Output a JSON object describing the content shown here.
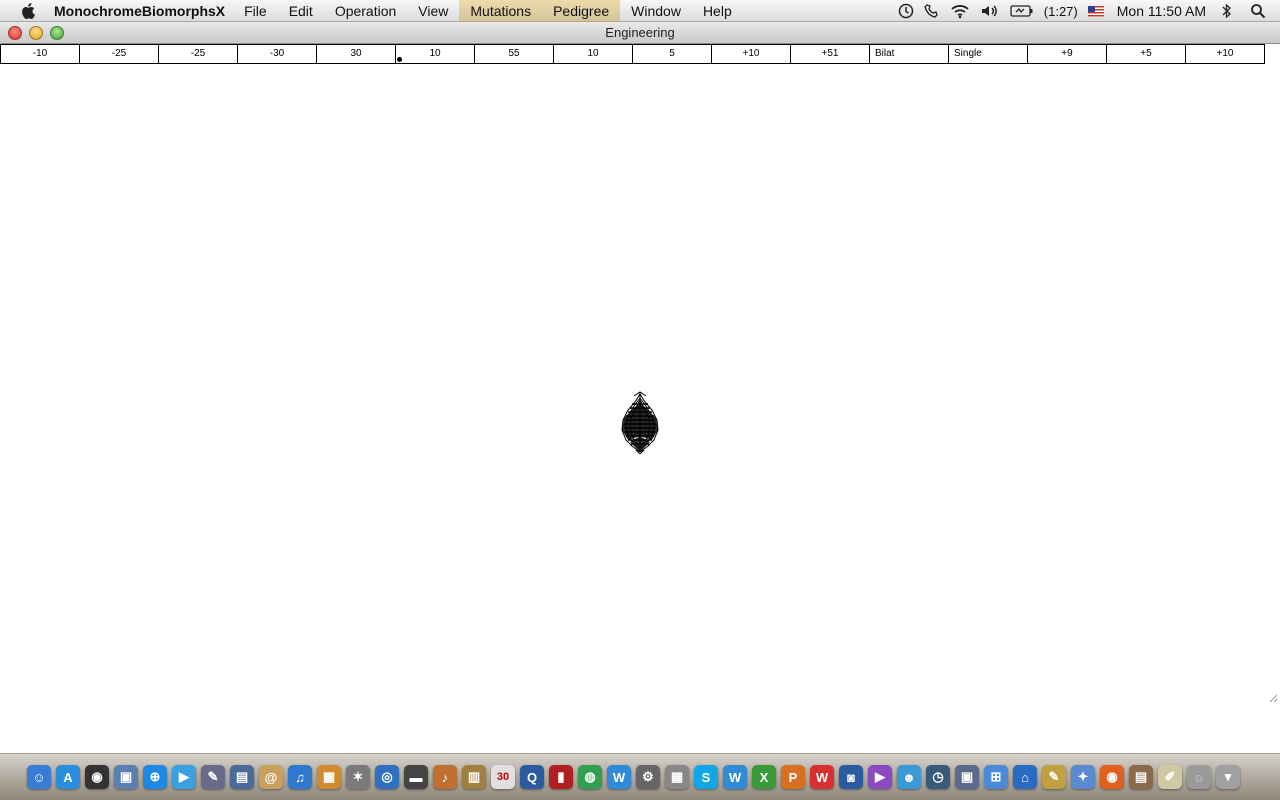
{
  "menubar": {
    "app_name": "MonochromeBiomorphsX",
    "items": [
      "File",
      "Edit",
      "Operation",
      "View",
      "Mutations",
      "Pedigree",
      "Window",
      "Help"
    ],
    "status": {
      "battery_text": "(1:27)",
      "clock": "Mon 11:50 AM"
    }
  },
  "window": {
    "title": "Engineering"
  },
  "genes": [
    "-10",
    "-25",
    "-25",
    "-30",
    "30",
    "10",
    "55",
    "10",
    "5",
    "+10",
    "+51",
    "Bilat",
    "Single",
    "+9",
    "+5",
    "+10"
  ],
  "colors": {
    "menubar_bg": "#e8e8e8",
    "canvas_bg": "#ffffff",
    "biomorph": "#000000"
  },
  "dock": {
    "icons": [
      {
        "name": "finder",
        "color": "#3a7bd5",
        "glyph": "☺"
      },
      {
        "name": "app-store",
        "color": "#2b8de0",
        "glyph": "A"
      },
      {
        "name": "dashboard",
        "color": "#333333",
        "glyph": "◉"
      },
      {
        "name": "preview",
        "color": "#5b7fb0",
        "glyph": "▣"
      },
      {
        "name": "safari",
        "color": "#1e88e5",
        "glyph": "⊕"
      },
      {
        "name": "facetime",
        "color": "#3aa0e0",
        "glyph": "▶"
      },
      {
        "name": "xcode-instruments",
        "color": "#6a6a8a",
        "glyph": "✎"
      },
      {
        "name": "system-info",
        "color": "#4a6a9a",
        "glyph": "▤"
      },
      {
        "name": "address-book",
        "color": "#c9a060",
        "glyph": "@"
      },
      {
        "name": "itunes",
        "color": "#2f7ad0",
        "glyph": "♫"
      },
      {
        "name": "iphoto",
        "color": "#d08a30",
        "glyph": "▦"
      },
      {
        "name": "stars",
        "color": "#7a7a7a",
        "glyph": "✶"
      },
      {
        "name": "dvd-player",
        "color": "#3070c0",
        "glyph": "◎"
      },
      {
        "name": "clapper",
        "color": "#444444",
        "glyph": "▬"
      },
      {
        "name": "garageband",
        "color": "#c07030",
        "glyph": "♪"
      },
      {
        "name": "keynote-chart",
        "color": "#a08040",
        "glyph": "▥"
      },
      {
        "name": "calendar",
        "color": "#e0e0e0",
        "glyph": "30"
      },
      {
        "name": "quicktime",
        "color": "#2a5aa0",
        "glyph": "Q"
      },
      {
        "name": "photo-booth",
        "color": "#b02020",
        "glyph": "▮"
      },
      {
        "name": "color-picker",
        "color": "#30a050",
        "glyph": "◍"
      },
      {
        "name": "word-w",
        "color": "#2f8ad8",
        "glyph": "W"
      },
      {
        "name": "hardware",
        "color": "#666666",
        "glyph": "⚙"
      },
      {
        "name": "calculator",
        "color": "#888888",
        "glyph": "▦"
      },
      {
        "name": "skype",
        "color": "#12a5e8",
        "glyph": "S"
      },
      {
        "name": "word-blue",
        "color": "#2f8ad8",
        "glyph": "W"
      },
      {
        "name": "excel-green",
        "color": "#3a9a3a",
        "glyph": "X"
      },
      {
        "name": "powerpoint",
        "color": "#d87020",
        "glyph": "P"
      },
      {
        "name": "wps",
        "color": "#d83030",
        "glyph": "W"
      },
      {
        "name": "camera",
        "color": "#2a5aa0",
        "glyph": "◙"
      },
      {
        "name": "media",
        "color": "#8a4ac0",
        "glyph": "▶"
      },
      {
        "name": "messenger",
        "color": "#3a9ad8",
        "glyph": "☻"
      },
      {
        "name": "time-machine",
        "color": "#3a5a7a",
        "glyph": "◷"
      },
      {
        "name": "screenshot",
        "color": "#5a6a8a",
        "glyph": "▣"
      },
      {
        "name": "network",
        "color": "#4a8ad8",
        "glyph": "⊞"
      },
      {
        "name": "home",
        "color": "#2a6ac0",
        "glyph": "⌂"
      },
      {
        "name": "notes",
        "color": "#c0a040",
        "glyph": "✎"
      },
      {
        "name": "utilities",
        "color": "#5a8ad0",
        "glyph": "✦"
      },
      {
        "name": "firefox",
        "color": "#e06020",
        "glyph": "◉"
      },
      {
        "name": "preview-photos",
        "color": "#8a6a4a",
        "glyph": "▤"
      },
      {
        "name": "textedit",
        "color": "#d0c8a0",
        "glyph": "✐"
      },
      {
        "name": "downloads",
        "color": "#9a9a9a",
        "glyph": "◌"
      },
      {
        "name": "trash",
        "color": "#a0a0a0",
        "glyph": "▾"
      }
    ]
  }
}
